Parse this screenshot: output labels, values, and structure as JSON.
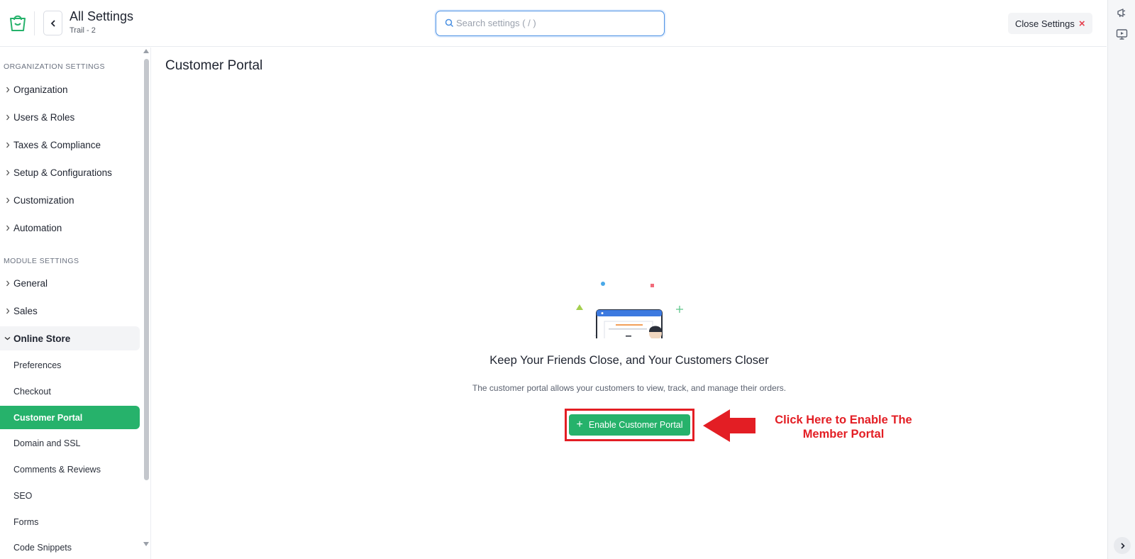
{
  "header": {
    "title": "All Settings",
    "subtitle": "Trail - 2",
    "search": {
      "placeholder": "Search settings ( / )",
      "value": ""
    },
    "close_label": "Close Settings",
    "close_icon": "×"
  },
  "sidebar": {
    "org_heading": "ORGANIZATION SETTINGS",
    "org_items": [
      {
        "label": "Organization"
      },
      {
        "label": "Users & Roles"
      },
      {
        "label": "Taxes & Compliance"
      },
      {
        "label": "Setup & Configurations"
      },
      {
        "label": "Customization"
      },
      {
        "label": "Automation"
      }
    ],
    "module_heading": "MODULE SETTINGS",
    "module_items": [
      {
        "label": "General"
      },
      {
        "label": "Sales"
      },
      {
        "label": "Online Store"
      }
    ],
    "online_store_sub": [
      {
        "label": "Preferences"
      },
      {
        "label": "Checkout"
      },
      {
        "label": "Customer Portal"
      },
      {
        "label": "Domain and SSL"
      },
      {
        "label": "Comments & Reviews"
      },
      {
        "label": "SEO"
      },
      {
        "label": "Forms"
      },
      {
        "label": "Code Snippets"
      }
    ]
  },
  "main": {
    "title": "Customer Portal",
    "empty_title": "Keep Your Friends Close, and Your Customers Closer",
    "empty_desc": "The customer portal allows your customers to view, track, and manage their orders.",
    "enable_button": "Enable Customer Portal",
    "plus_icon": "+",
    "annotation": "Click Here to Enable The Member Portal"
  },
  "colors": {
    "accent_green": "#26b26b",
    "annotation_red": "#e31e24",
    "search_border": "#4a90e2"
  },
  "icons": [
    "store-bag-icon",
    "chevron-left-icon",
    "search-icon",
    "close-icon",
    "megaphone-icon",
    "presentation-icon",
    "chevron-right-icon",
    "chevron-down-icon",
    "red-arrow-icon"
  ]
}
